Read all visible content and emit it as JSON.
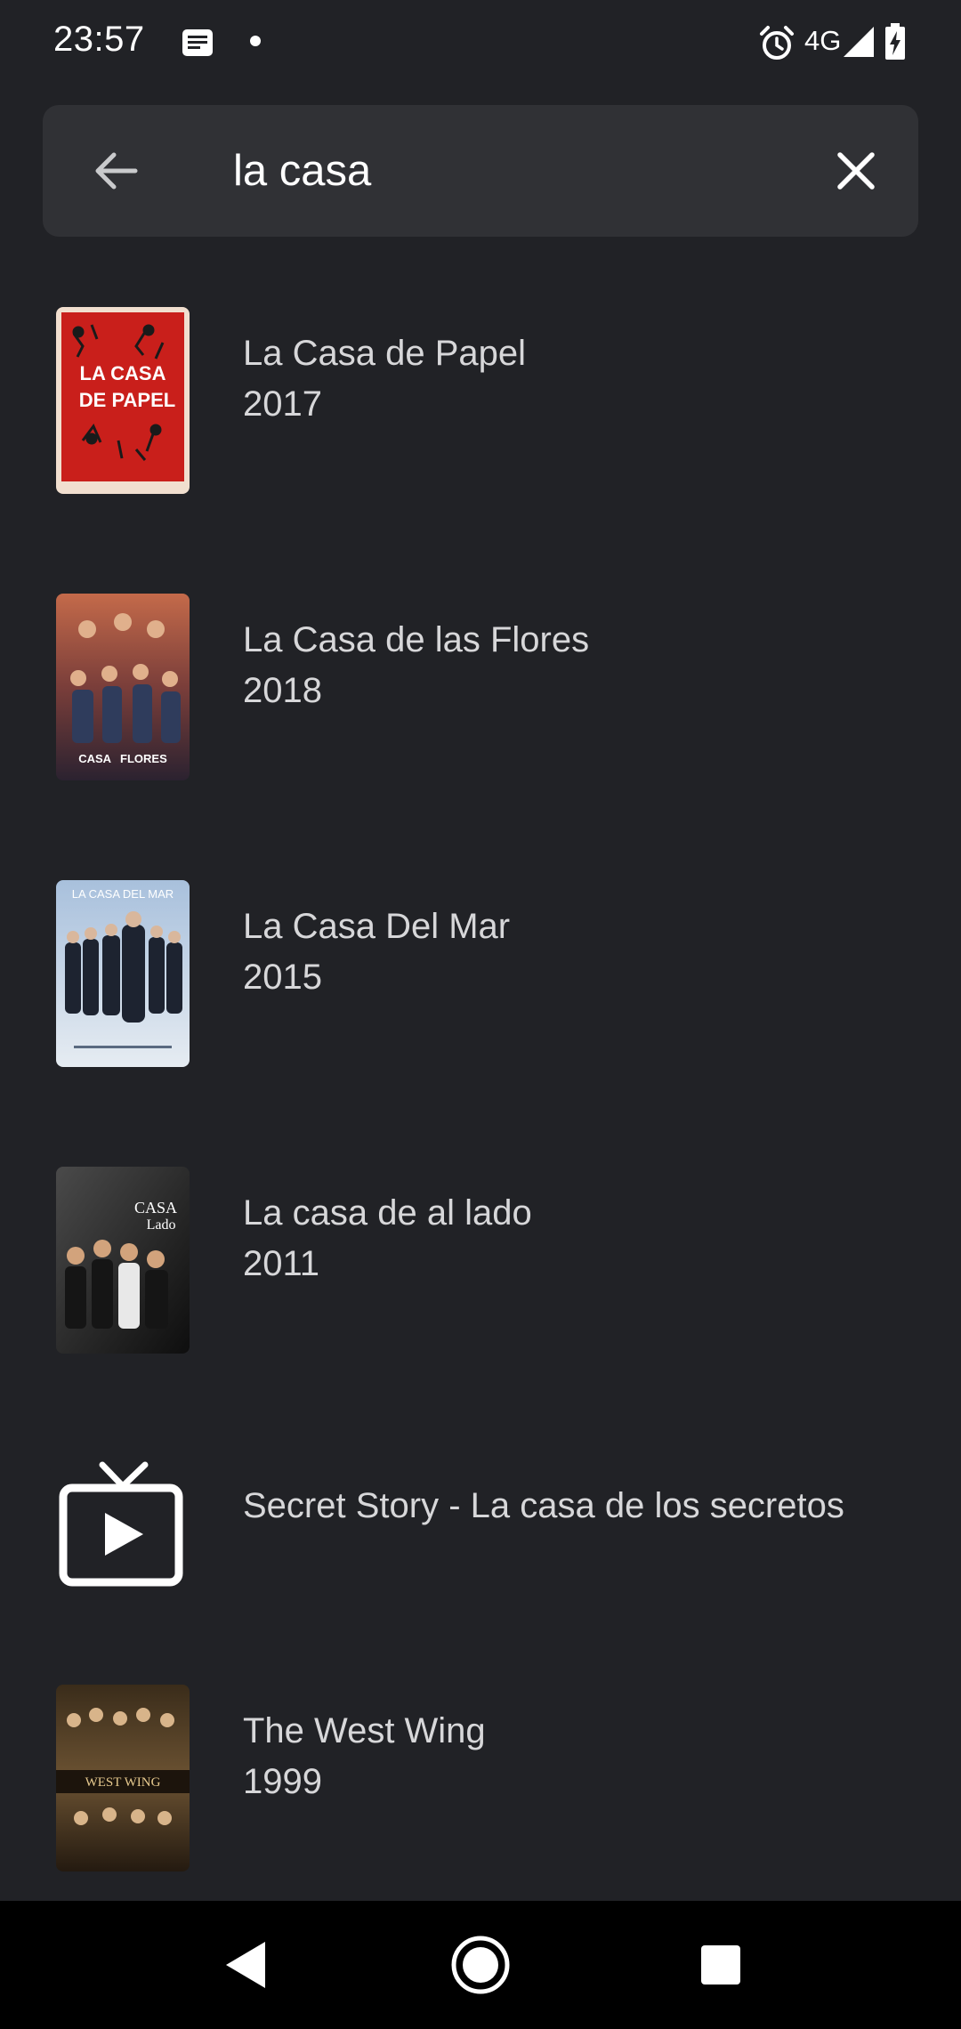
{
  "status_bar": {
    "time": "23:57",
    "network": "4G",
    "icons": [
      "message-icon",
      "alarm-icon",
      "signal-icon",
      "battery-charging-icon"
    ]
  },
  "search": {
    "query": "la casa",
    "back_icon": "arrow-left-icon",
    "clear_icon": "close-icon"
  },
  "results": [
    {
      "title": "La Casa de Papel",
      "year": "2017",
      "poster_text": [
        "LA CASA",
        "DE PAPEL"
      ]
    },
    {
      "title": "La Casa de las Flores",
      "year": "2018",
      "poster_text": [
        "CASA",
        "FLORES"
      ]
    },
    {
      "title": "La Casa Del Mar",
      "year": "2015",
      "poster_text": [
        "LA CASA DEL MAR"
      ]
    },
    {
      "title": "La casa de al lado",
      "year": "2011",
      "poster_text": [
        "CASA",
        "Lado"
      ]
    },
    {
      "title": "Secret Story - La casa de los secretos",
      "year": "",
      "icon": "tv-play-icon"
    },
    {
      "title": "The West Wing",
      "year": "1999",
      "poster_text": [
        "WEST WING"
      ]
    }
  ],
  "colors": {
    "background": "#212226",
    "search_bar": "#303135",
    "text_primary": "#d7d7d9",
    "nav_bar": "#000000"
  },
  "nav": {
    "icons": [
      "nav-back-icon",
      "nav-home-icon",
      "nav-recents-icon"
    ]
  }
}
